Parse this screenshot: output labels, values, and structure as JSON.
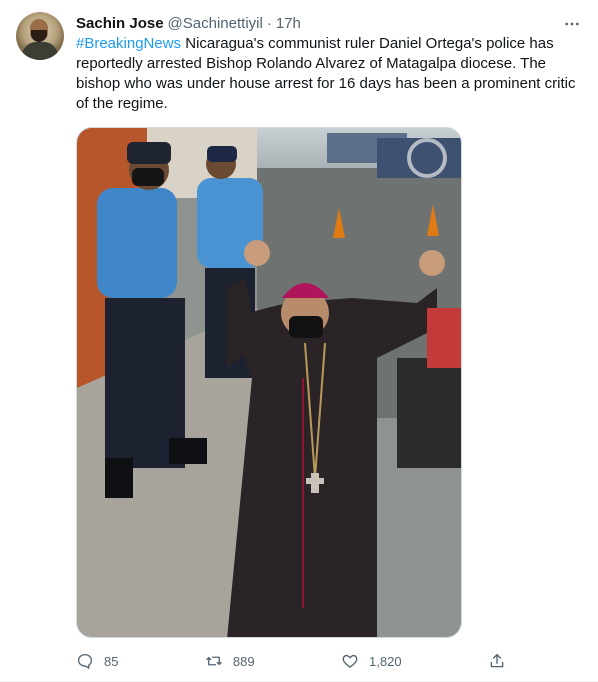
{
  "tweet": {
    "author_name": "Sachin Jose",
    "handle": "@Sachinettiyil",
    "separator": "·",
    "timestamp": "17h",
    "hashtag": "#BreakingNews",
    "body": " Nicaragua's communist ruler Daniel Ortega's police has reportedly arrested Bishop Rolando Alvarez of Matagalpa diocese. The bishop who was under house arrest for 16 days has been a prominent critic of the regime.",
    "counts": {
      "replies": "85",
      "retweets": "889",
      "likes": "1,820"
    }
  },
  "icons": {
    "more": "more-icon",
    "reply": "reply-icon",
    "retweet": "retweet-icon",
    "like": "heart-icon",
    "share": "share-icon"
  },
  "colors": {
    "link": "#1d9bf0",
    "secondary_text": "#536471",
    "primary_text": "#0f1419"
  }
}
